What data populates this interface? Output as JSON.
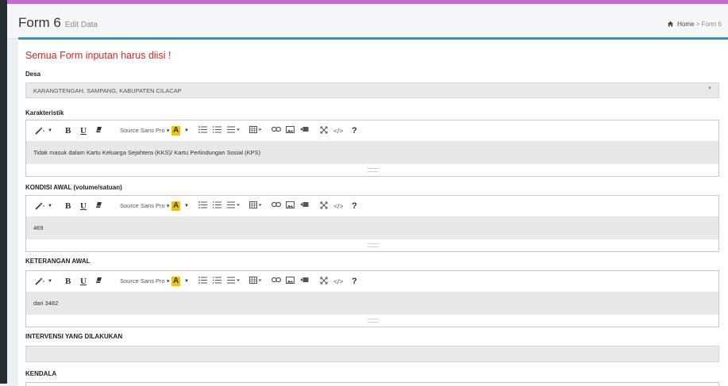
{
  "header": {
    "title": "Form 6",
    "subtitle": "Edit Data",
    "breadcrumb": {
      "home": "Home",
      "separator": ">",
      "current": "Form 6"
    }
  },
  "alert": "Semua Form inputan harus diisi !",
  "desa": {
    "label": "Desa",
    "selected": "KARANGTENGAH, SAMPANG, KABUPATEN CILACAP"
  },
  "toolbar": {
    "font_name": "Source Sans Pro",
    "highlight_letter": "A",
    "bold": "B",
    "underline": "U",
    "code_view": "</>",
    "help": "?",
    "icons": [
      "magic-icon",
      "bold-icon",
      "underline-icon",
      "eraser-icon",
      "font-name-dropdown",
      "highlight-color-icon",
      "color-dropdown-caret",
      "unordered-list-icon",
      "ordered-list-icon",
      "paragraph-align-icon",
      "table-icon",
      "link-icon",
      "picture-icon",
      "video-icon",
      "fullscreen-icon",
      "code-view-icon",
      "help-icon"
    ]
  },
  "fields": {
    "karakteristik": {
      "label": "Karakteristik",
      "value": "Tidak masuk dalam Kartu Keluarga Sejahtera (KKS)/ Kartu Perlindungan Sosial (KPS)"
    },
    "kondisi_awal": {
      "label": "KONDISI AWAL (volume/satuan)",
      "value": "469"
    },
    "keterangan_awal": {
      "label": "KETERANGAN AWAL",
      "value": "dari 3482"
    },
    "intervensi": {
      "label": "INTERVENSI YANG DILAKUKAN",
      "value": ""
    },
    "kendala": {
      "label": "KENDALA"
    }
  },
  "colors": {
    "accent": "#3c8dbc",
    "alert": "#e02323",
    "sidebar": "#222d32",
    "top_strip": "#c86ad2",
    "highlight": "#f2c400"
  }
}
